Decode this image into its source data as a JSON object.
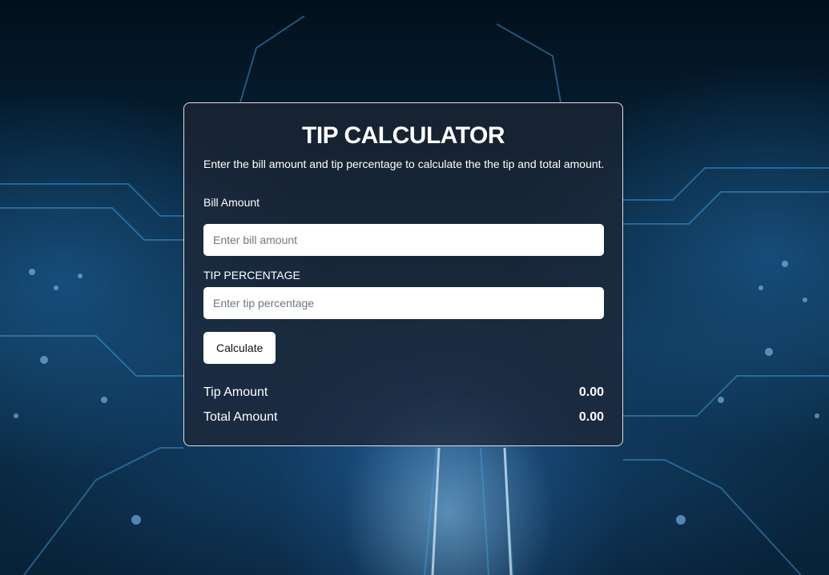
{
  "card": {
    "title": "TIP CALCULATOR",
    "subtitle": "Enter the bill amount and tip percentage to calculate the the tip and total amount.",
    "bill": {
      "label": "Bill Amount",
      "placeholder": "Enter bill amount",
      "value": ""
    },
    "tip": {
      "label": "TIP PERCENTAGE",
      "placeholder": "Enter tip percentage",
      "value": ""
    },
    "calculate_label": "Calculate",
    "results": {
      "tip_label": "Tip Amount",
      "tip_value": "0.00",
      "total_label": "Total Amount",
      "total_value": "0.00"
    }
  },
  "colors": {
    "accent_glow": "#8fd0ff",
    "card_border": "#ffffff",
    "card_background": "#1e2634"
  }
}
